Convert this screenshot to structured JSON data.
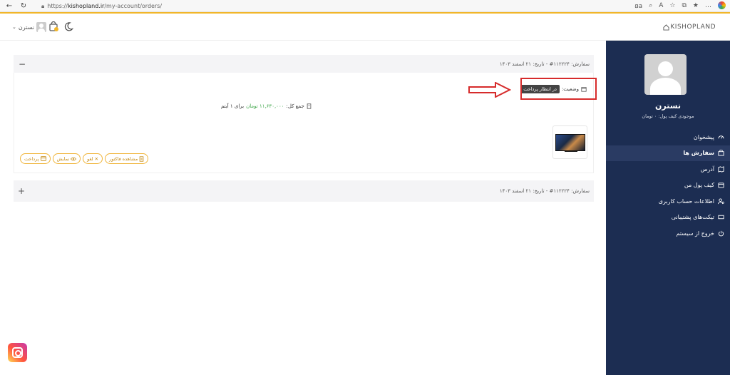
{
  "browser": {
    "url_host": "kishopland.ir",
    "url_path": "/my-account/orders/",
    "url_prefix": "https://"
  },
  "header": {
    "username": "نسترن",
    "logo": "KISHOPLAND"
  },
  "sidebar": {
    "name": "نسترن",
    "wallet": "موجودی کیف پول: ۰ تومان",
    "items": [
      {
        "label": "پیشخوان",
        "icon": "dashboard-icon"
      },
      {
        "label": "سفارش ها",
        "icon": "bag-icon",
        "active": true
      },
      {
        "label": "آدرس",
        "icon": "map-icon"
      },
      {
        "label": "کیف پول من",
        "icon": "wallet-icon"
      },
      {
        "label": "اطلاعات حساب کاربری",
        "icon": "user-settings-icon"
      },
      {
        "label": "تیکت‌های پشتیبانی",
        "icon": "ticket-icon"
      },
      {
        "label": "خروج از سیستم",
        "icon": "power-icon"
      }
    ]
  },
  "orders": [
    {
      "title": "سفارش: ۱۱۲۲۲۴# - تاریخ: ۲۱ اسفند ۱۴۰۳",
      "toggle": "−",
      "status_label": "وضعیت:",
      "status_value": "در انتظار پرداخت",
      "total_label": "جمع کل:",
      "total_value": "۱۱,۶۳۰,۰۰۰ تومان",
      "total_suffix": "برای ۱ آیتم",
      "actions": [
        "پرداخت",
        "نمایش",
        "لغو",
        "مشاهده فاکتور"
      ]
    },
    {
      "title": "سفارش: ۱۱۲۲۲۴# - تاریخ: ۲۱ اسفند ۱۴۰۳",
      "toggle": "+"
    }
  ]
}
